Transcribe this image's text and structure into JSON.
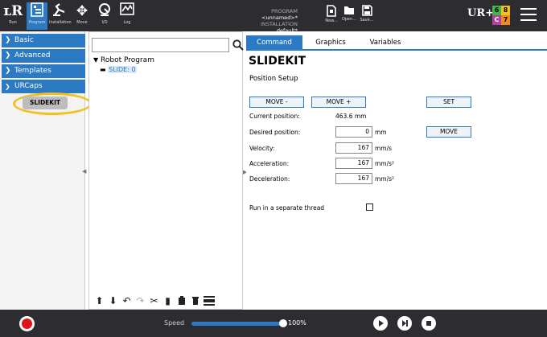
{
  "header": {
    "tabs": [
      {
        "label": "Run",
        "icon": "ur-logo-icon"
      },
      {
        "label": "Program",
        "icon": "program-icon"
      },
      {
        "label": "Installation",
        "icon": "installation-icon"
      },
      {
        "label": "Move",
        "icon": "move-icon"
      },
      {
        "label": "I/O",
        "icon": "io-icon"
      },
      {
        "label": "Log",
        "icon": "log-icon"
      }
    ],
    "program_label": "PROGRAM",
    "program_value": "<unnamed>*",
    "installation_label": "INSTALLATION",
    "installation_value": "default*",
    "file_buttons": [
      "New...",
      "Open...",
      "Save..."
    ],
    "logo_text": "UR+",
    "counter": {
      "top_left": "6",
      "top_right": "8",
      "bottom_left": "C",
      "bottom_right": "7"
    },
    "colors": {
      "bar": "#2d2d31",
      "accent": "#2c79c4"
    }
  },
  "sidebar": {
    "categories": [
      "Basic",
      "Advanced",
      "Templates",
      "URCaps"
    ],
    "urcap_item": "SLIDEKIT",
    "highlight_color": "#f3c01d"
  },
  "tree": {
    "search_placeholder": "",
    "root": "Robot Program",
    "child": "SLIDE: 0"
  },
  "tabs": [
    "Command",
    "Graphics",
    "Variables"
  ],
  "active_tab": "Command",
  "node": {
    "title": "SLIDEKIT",
    "section": "Position Setup",
    "buttons": {
      "move_minus": "MOVE -",
      "move_plus": "MOVE +",
      "set": "SET",
      "move": "MOVE"
    },
    "current_position_label": "Current position:",
    "current_position_value": "463.6 mm",
    "fields": [
      {
        "label": "Desired position:",
        "value": "0",
        "unit": "mm"
      },
      {
        "label": "Velocity:",
        "value": "167",
        "unit": "mm/s"
      },
      {
        "label": "Acceleration:",
        "value": "167",
        "unit": "mm/s²"
      },
      {
        "label": "Deceleration:",
        "value": "167",
        "unit": "mm/s²"
      }
    ],
    "thread_label": "Run in a separate thread",
    "thread_checked": false
  },
  "footer": {
    "speed_label": "Speed",
    "speed_value": "100%",
    "speed_fraction": 1.0,
    "stop_color": "#e0121a"
  }
}
